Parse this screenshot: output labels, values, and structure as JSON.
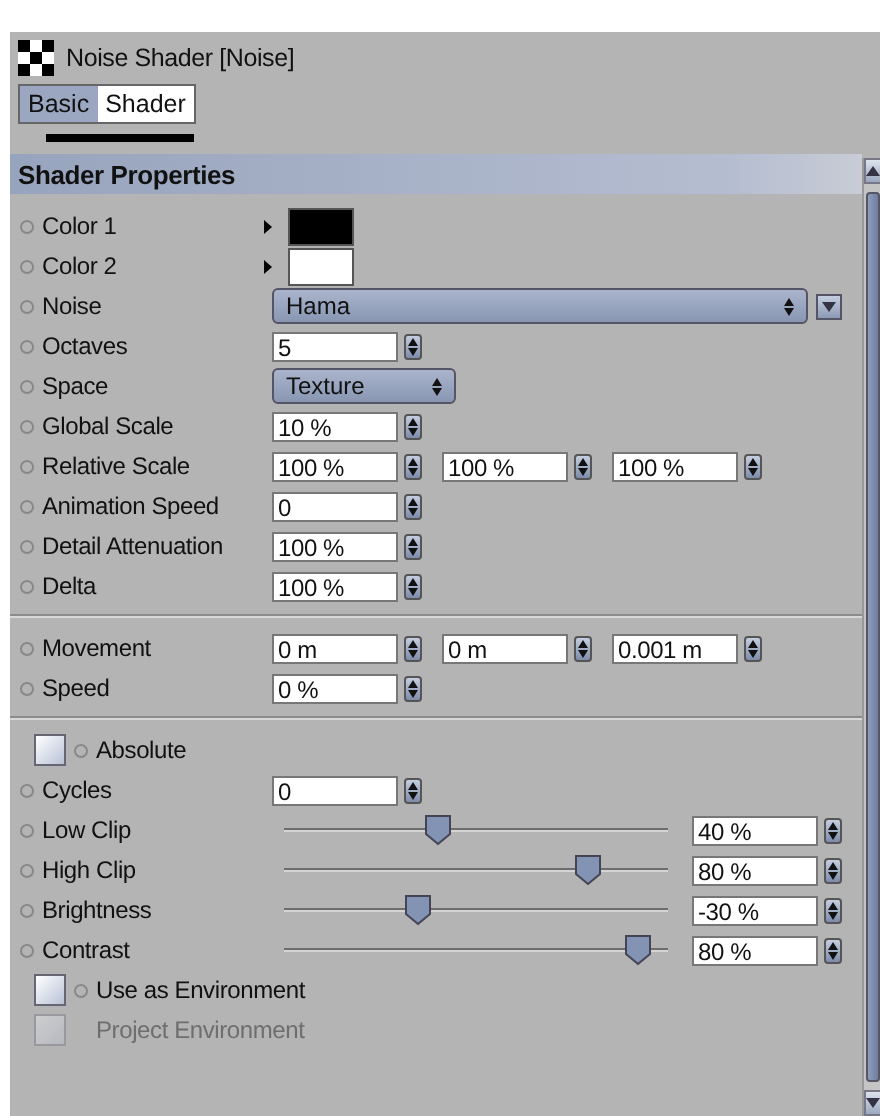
{
  "window": {
    "title": "Noise Shader [Noise]"
  },
  "tabs": [
    {
      "label": "Basic",
      "selected": false
    },
    {
      "label": "Shader",
      "selected": true
    }
  ],
  "section": {
    "title": "Shader Properties"
  },
  "rows": [
    {
      "kind": "color",
      "label": "Color 1",
      "color": "#000000"
    },
    {
      "kind": "color",
      "label": "Color 2",
      "color": "#ffffff"
    },
    {
      "kind": "dropdown",
      "label": "Noise",
      "value": "Hama",
      "wide": true
    },
    {
      "kind": "number",
      "label": "Octaves",
      "fields": [
        "5"
      ]
    },
    {
      "kind": "dropdown",
      "label": "Space",
      "value": "Texture",
      "wide": false
    },
    {
      "kind": "number",
      "label": "Global Scale",
      "fields": [
        "10 %"
      ]
    },
    {
      "kind": "number",
      "label": "Relative Scale",
      "fields": [
        "100 %",
        "100 %",
        "100 %"
      ]
    },
    {
      "kind": "number",
      "label": "Animation Speed",
      "fields": [
        "0"
      ]
    },
    {
      "kind": "number",
      "label": "Detail Attenuation",
      "fields": [
        "100 %"
      ]
    },
    {
      "kind": "number",
      "label": "Delta",
      "fields": [
        "100 %"
      ]
    },
    {
      "kind": "separator"
    },
    {
      "kind": "number",
      "label": "Movement",
      "fields": [
        "0 m",
        "0 m",
        "0.001 m"
      ]
    },
    {
      "kind": "number",
      "label": "Speed",
      "fields": [
        "0 %"
      ]
    },
    {
      "kind": "separator"
    },
    {
      "kind": "checkbox",
      "label": "Absolute",
      "checked": false,
      "disabled": false
    },
    {
      "kind": "number",
      "label": "Cycles",
      "fields": [
        "0"
      ]
    },
    {
      "kind": "slider",
      "label": "Low Clip",
      "level": 0.4,
      "value": "40 %"
    },
    {
      "kind": "slider",
      "label": "High Clip",
      "level": 0.79,
      "value": "80 %"
    },
    {
      "kind": "slider",
      "label": "Brightness",
      "level": 0.35,
      "value": "-30 %"
    },
    {
      "kind": "slider",
      "label": "Contrast",
      "level": 0.92,
      "value": "80 %"
    },
    {
      "kind": "checkbox",
      "label": "Use as Environment",
      "checked": false,
      "disabled": false
    },
    {
      "kind": "checkbox",
      "label": "Project Environment",
      "checked": false,
      "disabled": true
    }
  ]
}
